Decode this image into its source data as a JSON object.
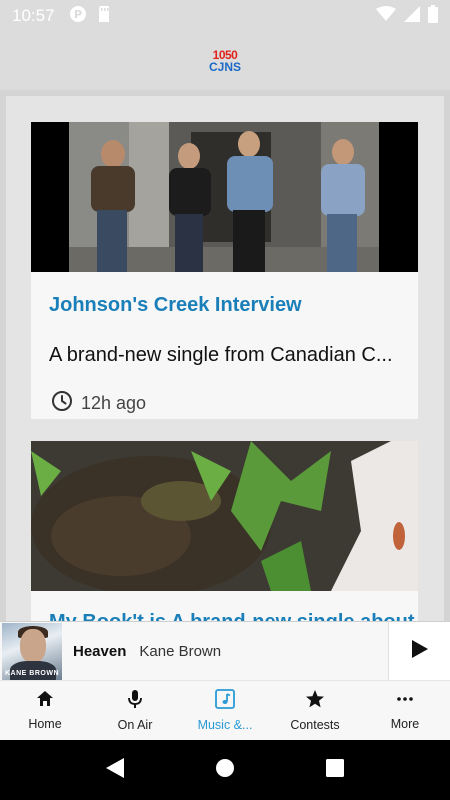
{
  "status_bar": {
    "time": "10:57",
    "left_icons": [
      "app-notification-icon",
      "sd-card-icon"
    ],
    "right_icons": [
      "wifi-icon",
      "signal-icon",
      "battery-icon"
    ]
  },
  "header": {
    "logo_top": "1050",
    "logo_bottom": "CJNS"
  },
  "feed": {
    "cards": [
      {
        "title": "Johnson's Creek Interview",
        "description": "A brand-new single from Canadian C...",
        "time_ago": "12h ago",
        "image": "band-photo"
      },
      {
        "title": "My Book't is A brand-new single about it all",
        "image": "grass-and-dirt-photo"
      }
    ]
  },
  "player": {
    "song_title": "Heaven",
    "artist": "Kane Brown",
    "album_label": "KANE BROWN",
    "play_icon": "play-icon"
  },
  "bottom_nav": {
    "items": [
      {
        "label": "Home",
        "icon": "home-icon",
        "active": false
      },
      {
        "label": "On Air",
        "icon": "microphone-icon",
        "active": false
      },
      {
        "label": "Music &...",
        "icon": "music-note-icon",
        "active": true
      },
      {
        "label": "Contests",
        "icon": "star-icon",
        "active": false
      },
      {
        "label": "More",
        "icon": "more-dots-icon",
        "active": false
      }
    ]
  },
  "colors": {
    "accent": "#2a9ad6",
    "title_blue": "#1a7fb8",
    "header_bg": "#dcdcdc",
    "logo_red": "#e0231b",
    "logo_blue": "#1c6ac7"
  }
}
